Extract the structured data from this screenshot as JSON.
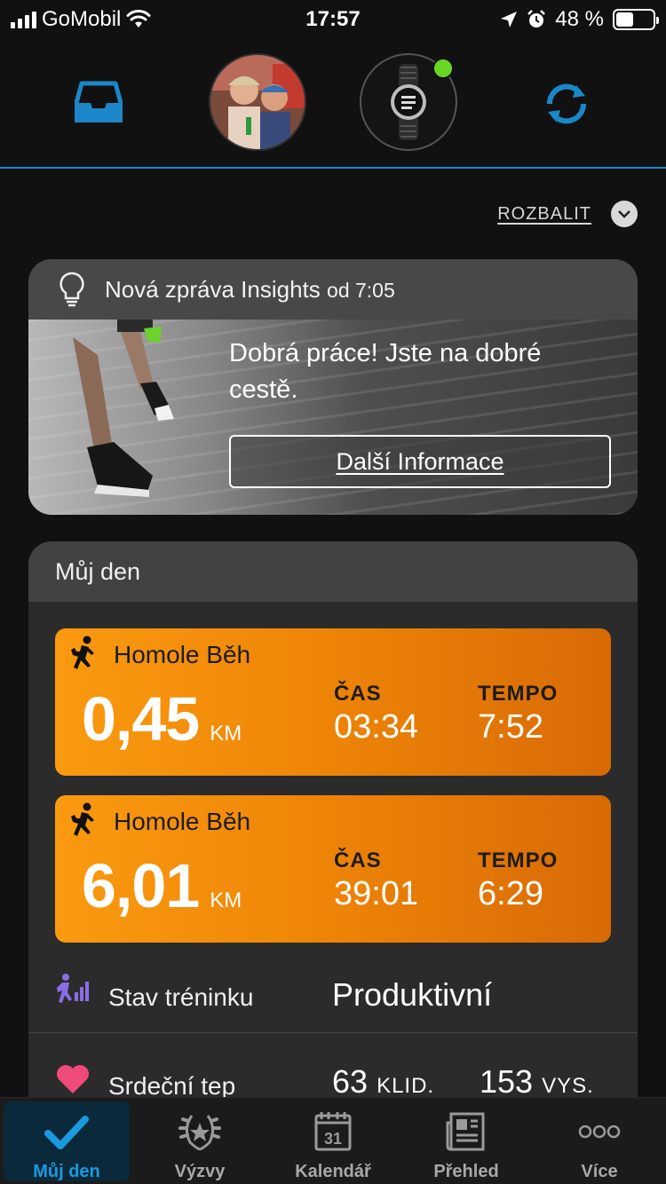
{
  "status_bar": {
    "carrier": "GoMobil",
    "time": "17:57",
    "battery_pct": "48 %",
    "battery_level": 0.48
  },
  "header": {
    "icons": [
      "inbox-icon",
      "avatar",
      "watch-device",
      "sync-icon"
    ],
    "accent": "#1b87c9",
    "device_status_color": "#6ad624"
  },
  "expand": {
    "label": "ROZBALIT"
  },
  "insights": {
    "title": "Nová zpráva Insights",
    "time": "od 7:05",
    "message": "Dobrá práce! Jste na dobré cestě.",
    "button": "Další Informace"
  },
  "my_day": {
    "title": "Můj den",
    "activities": [
      {
        "name": "Homole Běh",
        "distance": "0,45",
        "unit": "KM",
        "time_label": "ČAS",
        "time": "03:34",
        "pace_label": "TEMPO",
        "pace": "7:52"
      },
      {
        "name": "Homole Běh",
        "distance": "6,01",
        "unit": "KM",
        "time_label": "ČAS",
        "time": "39:01",
        "pace_label": "TEMPO",
        "pace": "6:29"
      }
    ],
    "training_status": {
      "label": "Stav tréninku",
      "value": "Produktivní"
    },
    "heart_rate": {
      "label": "Srdeční tep",
      "resting": "63",
      "resting_unit": "KLID.",
      "high": "153",
      "high_unit": "VYS."
    },
    "activity_color": "#ef8607"
  },
  "tabbar": {
    "tabs": [
      {
        "label": "Můj den",
        "icon": "check-icon",
        "active": true
      },
      {
        "label": "Výzvy",
        "icon": "laurel-icon",
        "active": false
      },
      {
        "label": "Kalendář",
        "icon": "calendar-icon",
        "active": false
      },
      {
        "label": "Přehled",
        "icon": "news-icon",
        "active": false
      },
      {
        "label": "Více",
        "icon": "more-icon",
        "active": false
      }
    ],
    "calendar_day": "31"
  }
}
